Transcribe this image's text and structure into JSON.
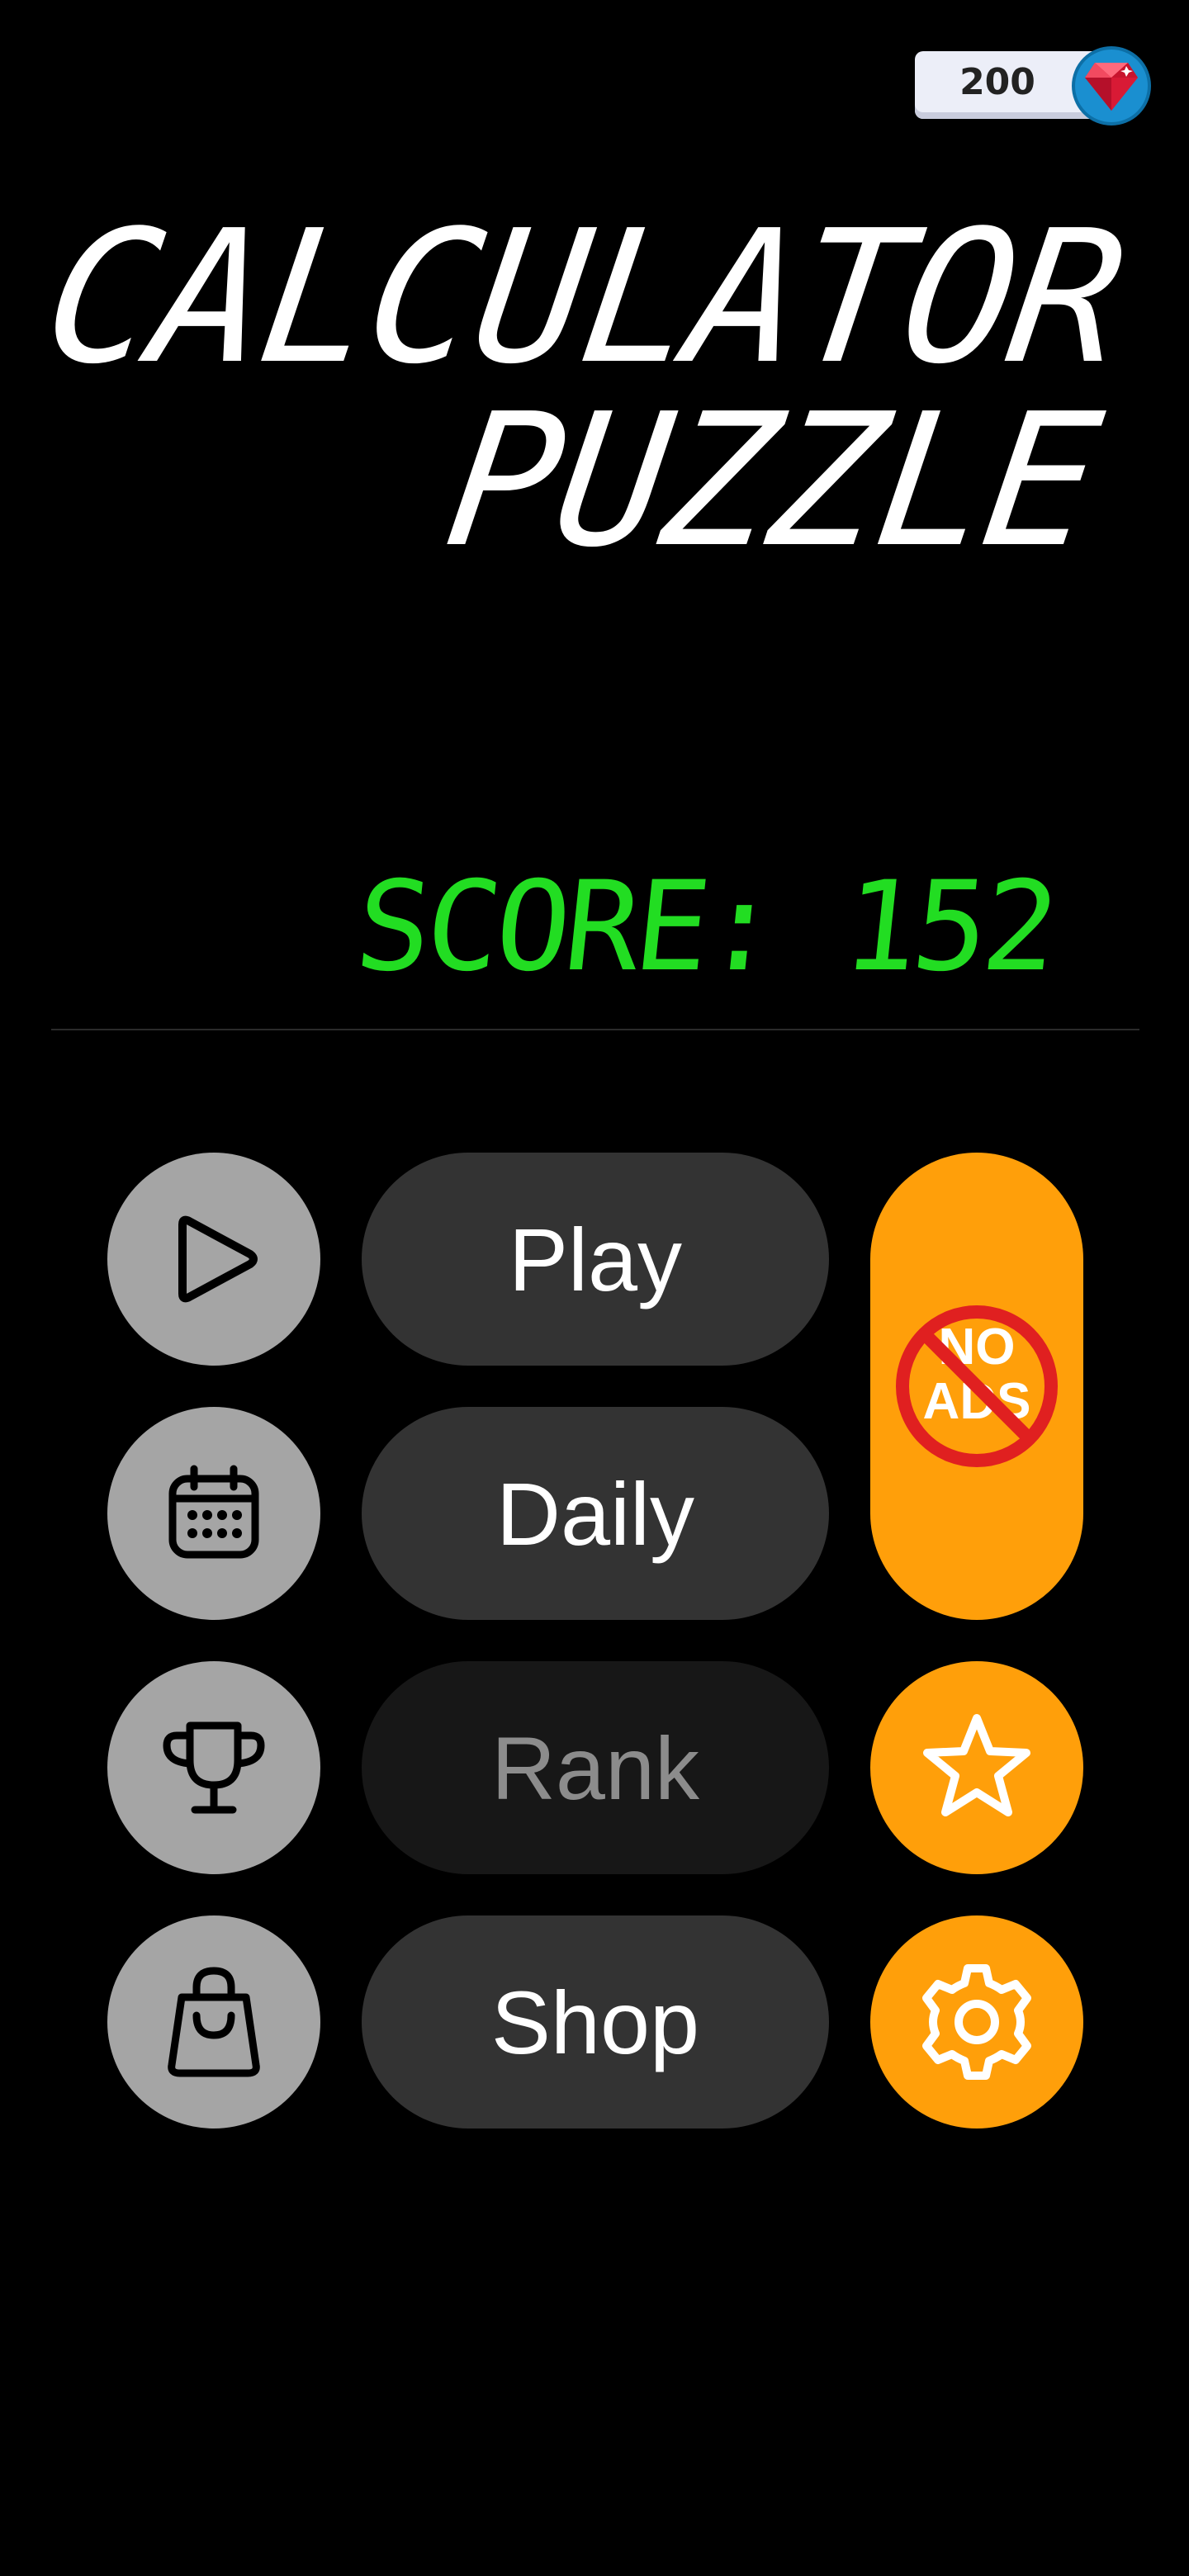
{
  "header": {
    "gem_count": "200",
    "gem_icon": "red-gem-icon"
  },
  "title": {
    "line1": "CALCULATOR",
    "line2": "PUZZLE"
  },
  "score": {
    "label": "SCORE:",
    "value": "152"
  },
  "menu": {
    "items": [
      {
        "icon": "play-icon",
        "label": "Play",
        "enabled": true
      },
      {
        "icon": "calendar-icon",
        "label": "Daily",
        "enabled": true
      },
      {
        "icon": "trophy-icon",
        "label": "Rank",
        "enabled": false
      },
      {
        "icon": "shopping-bag-icon",
        "label": "Shop",
        "enabled": true
      }
    ],
    "side": {
      "no_ads_line1": "NO",
      "no_ads_line2": "ADS",
      "rate_icon": "star-icon",
      "settings_icon": "gear-icon"
    }
  },
  "colors": {
    "background": "#000000",
    "score": "#22dd22",
    "accent": "#ff9f0a",
    "circle_button": "#a5a5a5",
    "pill_button": "#333333",
    "pill_disabled": "#171717",
    "no_ads_ring": "#e02020"
  }
}
